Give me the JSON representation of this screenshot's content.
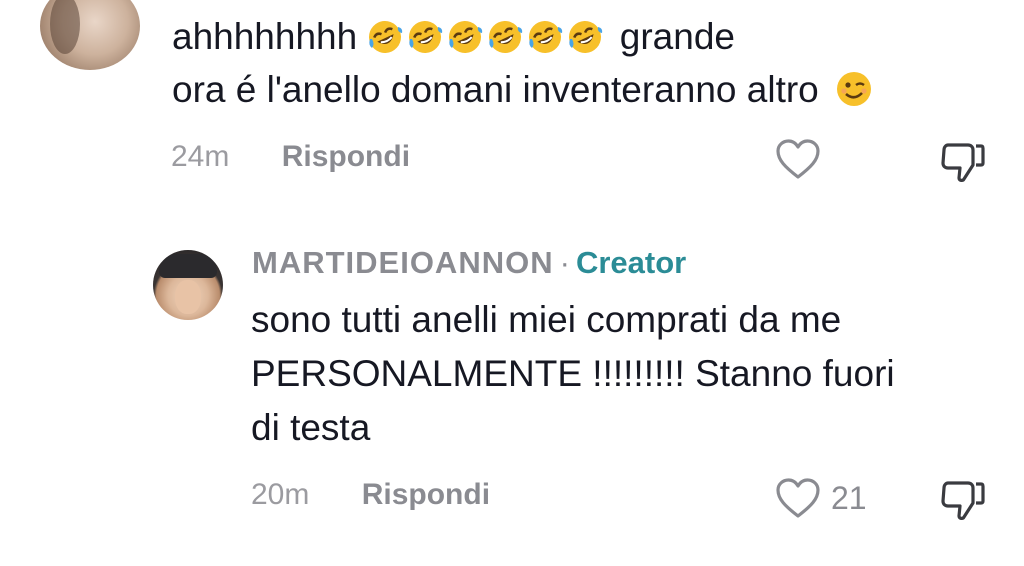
{
  "comment1": {
    "text_line1_prefix": "ahhhhhhhh",
    "emojis": [
      "rofl-emoji",
      "rofl-emoji",
      "rofl-emoji",
      "rofl-emoji",
      "rofl-emoji",
      "rofl-emoji"
    ],
    "text_line1_suffix": "grande",
    "text_line2": "ora é l'anello domani inventeranno altro",
    "trailing_emoji": "wink-emoji",
    "time": "24m",
    "reply_label": "Rispondi"
  },
  "comment2": {
    "username": "MARTIDEIOANNON",
    "separator": "·",
    "badge": "Creator",
    "text_line1": "sono tutti anelli miei comprati da me",
    "text_line2": "PERSONALMENTE !!!!!!!!! Stanno fuori",
    "text_line3": "di testa",
    "time": "20m",
    "reply_label": "Rispondi",
    "like_count": "21"
  },
  "colors": {
    "text": "#161823",
    "muted": "#8a8b91",
    "creator": "#2b8c96"
  }
}
